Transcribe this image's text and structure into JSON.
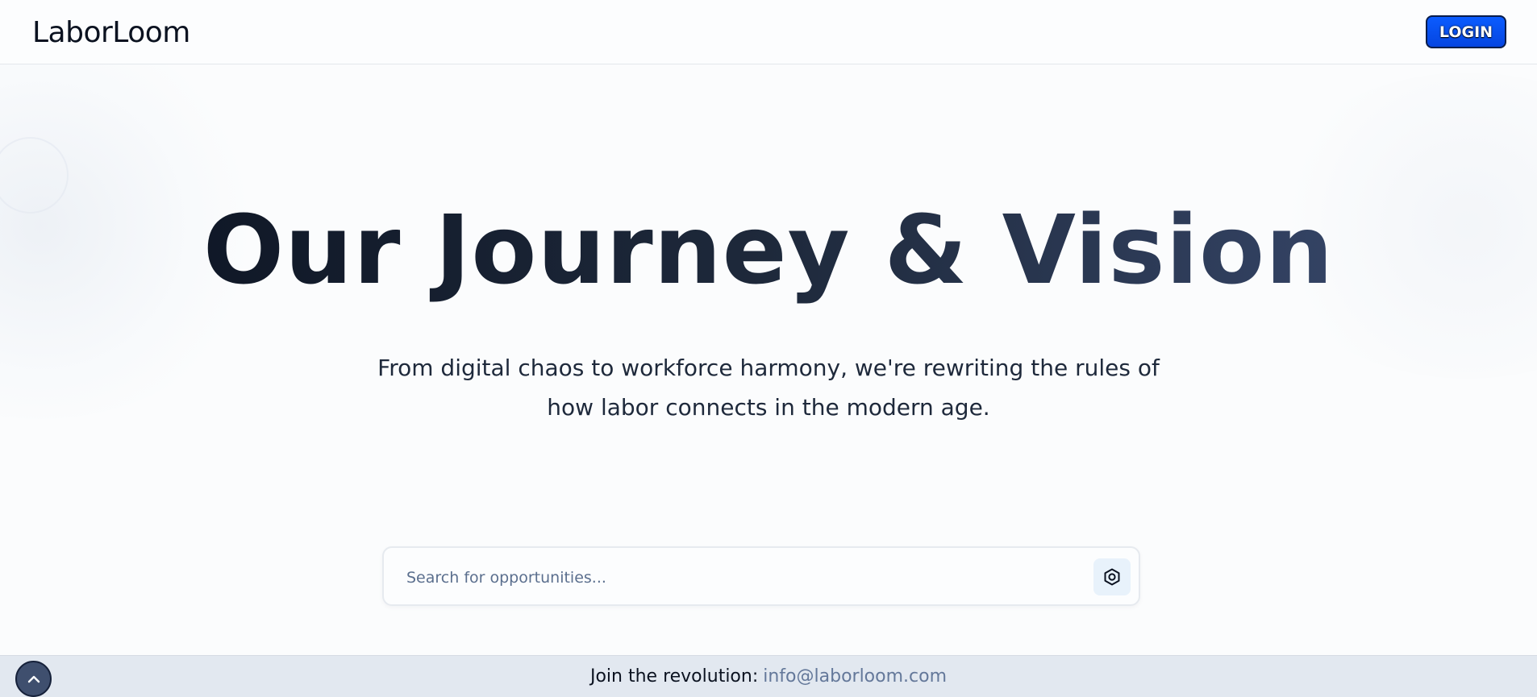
{
  "header": {
    "brand": "LaborLoom",
    "login_label": "LOGIN"
  },
  "hero": {
    "title": "Our Journey & Vision",
    "subtitle_line1": "From digital chaos to workforce harmony, we're rewriting the rules of",
    "subtitle_line2": "how labor connects in the modern age."
  },
  "search": {
    "placeholder": "Search for opportunities...",
    "button_icon": "hexagon-settings-icon"
  },
  "footer": {
    "text": "Join the revolution:",
    "email": "info@laborloom.com"
  },
  "scroll_top": {
    "icon": "chevron-up-icon"
  },
  "colors": {
    "accent": "#0b5cff",
    "footer_bg": "#e2e8f0",
    "link": "#64789a"
  }
}
